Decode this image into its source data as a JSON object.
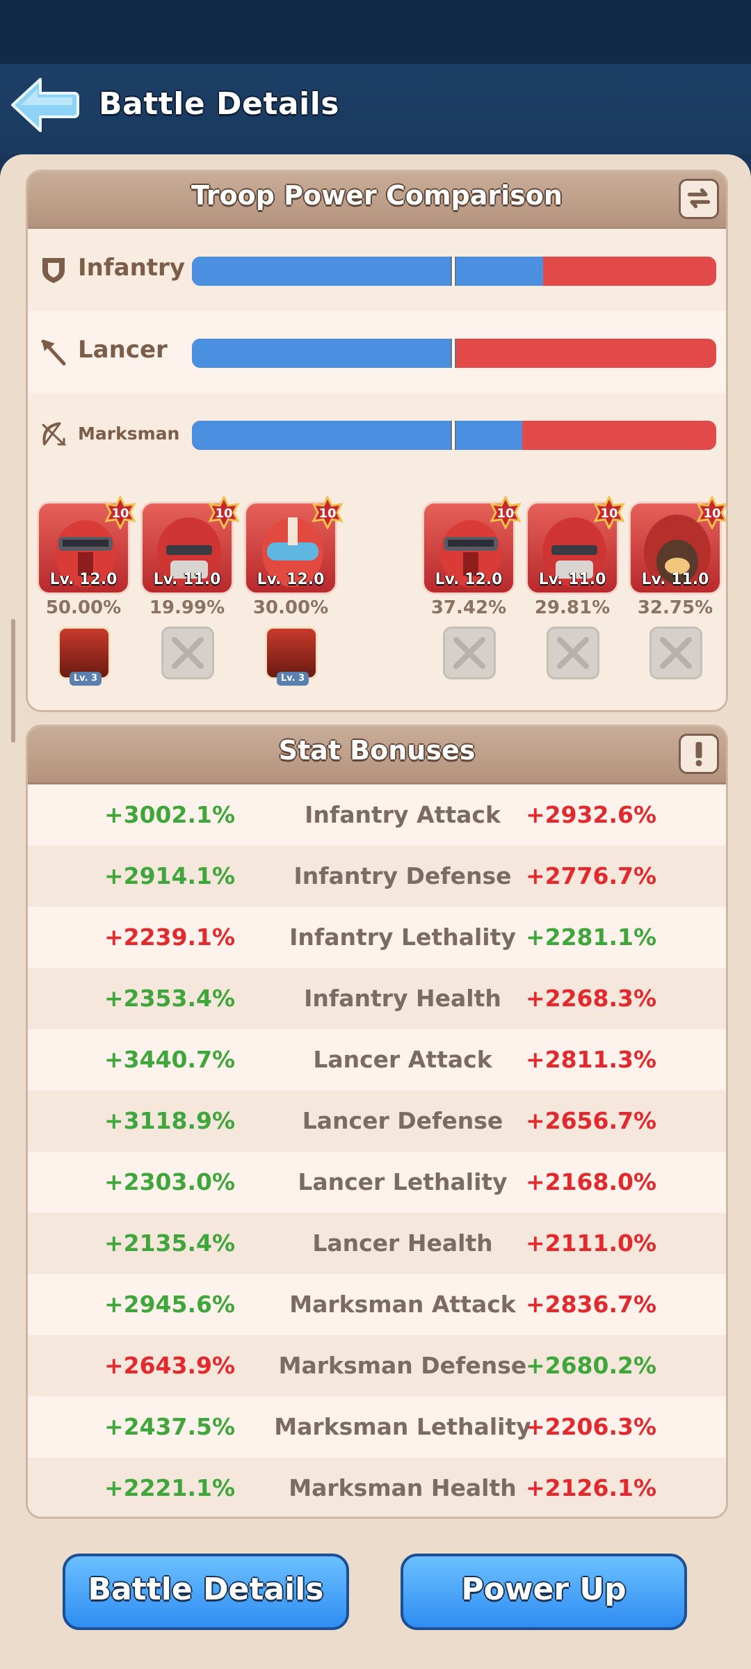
{
  "header": {
    "title": "Battle Details"
  },
  "troop_panel": {
    "title": "Troop Power Comparison",
    "rows": [
      {
        "label": "Infantry",
        "left_share": 0.67
      },
      {
        "label": "Lancer",
        "left_share": 0.5
      },
      {
        "label": "Marksman",
        "left_share": 0.63
      }
    ],
    "left_heroes": [
      {
        "level": "Lv. 12.0",
        "stars": "10",
        "pct": "50.00%",
        "gear_level": "Lv. 3"
      },
      {
        "level": "Lv. 11.0",
        "stars": "10",
        "pct": "19.99%"
      },
      {
        "level": "Lv. 12.0",
        "stars": "10",
        "pct": "30.00%",
        "gear_level": "Lv. 3"
      }
    ],
    "right_heroes": [
      {
        "level": "Lv. 12.0",
        "stars": "10",
        "pct": "37.42%"
      },
      {
        "level": "Lv. 11.0",
        "stars": "10",
        "pct": "29.81%"
      },
      {
        "level": "Lv. 11.0",
        "stars": "10",
        "pct": "32.75%"
      }
    ]
  },
  "stat_panel": {
    "title": "Stat Bonuses",
    "rows": [
      {
        "left": "+3002.1%",
        "label": "Infantry Attack",
        "right": "+2932.6%"
      },
      {
        "left": "+2914.1%",
        "label": "Infantry Defense",
        "right": "+2776.7%"
      },
      {
        "left": "+2239.1%",
        "label": "Infantry Lethality",
        "right": "+2281.1%"
      },
      {
        "left": "+2353.4%",
        "label": "Infantry Health",
        "right": "+2268.3%"
      },
      {
        "left": "+3440.7%",
        "label": "Lancer Attack",
        "right": "+2811.3%"
      },
      {
        "left": "+3118.9%",
        "label": "Lancer Defense",
        "right": "+2656.7%"
      },
      {
        "left": "+2303.0%",
        "label": "Lancer Lethality",
        "right": "+2168.0%"
      },
      {
        "left": "+2135.4%",
        "label": "Lancer Health",
        "right": "+2111.0%"
      },
      {
        "left": "+2945.6%",
        "label": "Marksman Attack",
        "right": "+2836.7%"
      },
      {
        "left": "+2643.9%",
        "label": "Marksman Defense",
        "right": "+2680.2%"
      },
      {
        "left": "+2437.5%",
        "label": "Marksman Lethality",
        "right": "+2206.3%"
      },
      {
        "left": "+2221.1%",
        "label": "Marksman Health",
        "right": "+2126.1%"
      }
    ]
  },
  "buttons": {
    "battle_details": "Battle Details",
    "power_up": "Power Up"
  },
  "colors": {
    "ally_bar": "#4a8fe0",
    "enemy_bar": "#e24a4a",
    "higher": "#3ea63a",
    "lower": "#e3292d"
  }
}
